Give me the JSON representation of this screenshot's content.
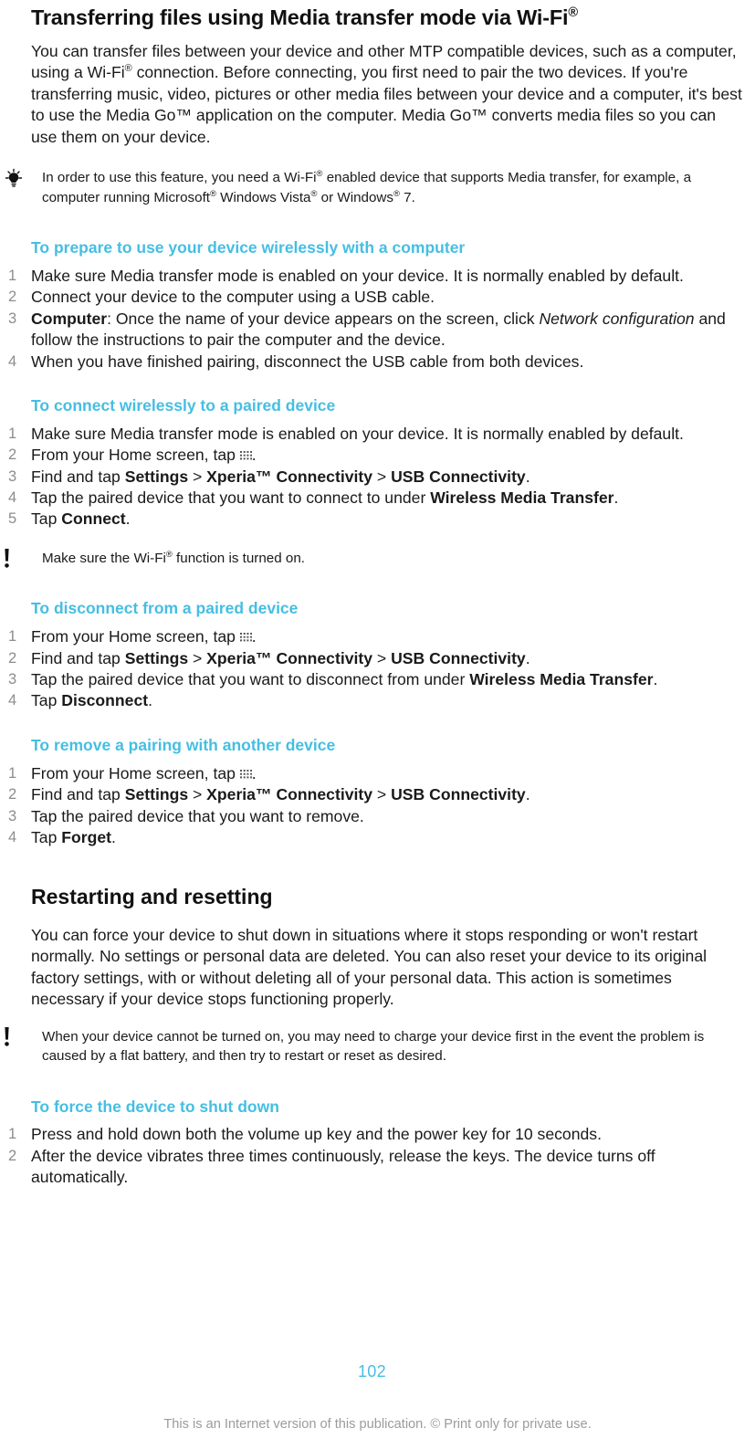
{
  "document": {
    "title_line": "Transferring files using Media transfer mode via Wi-Fi",
    "title_sup": "®",
    "intro_paragraph": {
      "p1": "You can transfer files between your device and other MTP compatible devices, such as a computer, using a Wi-Fi",
      "sup1": "®",
      "p2": " connection. Before connecting, you first need to pair the two devices. If you're transferring music, video, pictures or other media files between your device and a computer, it's best to use the Media Go™ application on the computer. Media Go™ converts media files so you can use them on your device."
    },
    "tip_note": {
      "icon": "lightbulb-icon",
      "t1": "In order to use this feature, you need a Wi-Fi",
      "sup1": "®",
      "t2": " enabled device that supports Media transfer, for example, a computer running Microsoft",
      "sup2": "®",
      "t3": " Windows Vista",
      "sup3": "®",
      "t4": " or Windows",
      "sup4": "®",
      "t5": " 7."
    },
    "section_prepare": {
      "heading": "To prepare to use your device wirelessly with a computer",
      "steps": [
        {
          "text": "Make sure Media transfer mode is enabled on your device. It is normally enabled by default."
        },
        {
          "text": "Connect your device to the computer using a USB cable."
        },
        {
          "bold_lead": "Computer",
          "text_a": ": Once the name of your device appears on the screen, click ",
          "italic": "Network configuration",
          "text_b": " and follow the instructions to pair the computer and the device."
        },
        {
          "text": "When you have finished pairing, disconnect the USB cable from both devices."
        }
      ]
    },
    "section_connect": {
      "heading": "To connect wirelessly to a paired device",
      "steps": {
        "s1": "Make sure Media transfer mode is enabled on your device. It is normally enabled by default.",
        "s2_a": "From your Home screen, tap ",
        "s2_icon": "app-drawer-icon",
        "s2_b": ".",
        "s3_a": "Find and tap ",
        "s3_b1": "Settings",
        "s3_sep1": " > ",
        "s3_b2": "Xperia™ Connectivity",
        "s3_sep2": " > ",
        "s3_b3": "USB Connectivity",
        "s3_end": ".",
        "s4_a": "Tap the paired device that you want to connect to under ",
        "s4_b": "Wireless Media Transfer",
        "s4_end": ".",
        "s5_a": "Tap ",
        "s5_b": "Connect",
        "s5_end": "."
      }
    },
    "warning_note_1": {
      "icon": "exclamation-icon",
      "t1": "Make sure the Wi-Fi",
      "sup1": "®",
      "t2": " function is turned on."
    },
    "section_disconnect": {
      "heading": "To disconnect from a paired device",
      "steps": {
        "s1_a": "From your Home screen, tap ",
        "s1_icon": "app-drawer-icon",
        "s1_b": ".",
        "s2_a": "Find and tap ",
        "s2_b1": "Settings",
        "s2_sep1": " > ",
        "s2_b2": "Xperia™ Connectivity",
        "s2_sep2": " > ",
        "s2_b3": "USB Connectivity",
        "s2_end": ".",
        "s3_a": "Tap the paired device that you want to disconnect from under ",
        "s3_b": "Wireless Media Transfer",
        "s3_end": ".",
        "s4_a": "Tap ",
        "s4_b": "Disconnect",
        "s4_end": "."
      }
    },
    "section_remove": {
      "heading": "To remove a pairing with another device",
      "steps": {
        "s1_a": "From your Home screen, tap ",
        "s1_icon": "app-drawer-icon",
        "s1_b": ".",
        "s2_a": "Find and tap ",
        "s2_b1": "Settings",
        "s2_sep1": " > ",
        "s2_b2": "Xperia™ Connectivity",
        "s2_sep2": " > ",
        "s2_b3": "USB Connectivity",
        "s2_end": ".",
        "s3": "Tap the paired device that you want to remove.",
        "s4_a": "Tap ",
        "s4_b": "Forget",
        "s4_end": "."
      }
    },
    "section_restart": {
      "heading": "Restarting and resetting",
      "paragraph": "You can force your device to shut down in situations where it stops responding or won't restart normally. No settings or personal data are deleted. You can also reset your device to its original factory settings, with or without deleting all of your personal data. This action is sometimes necessary if your device stops functioning properly."
    },
    "warning_note_2": {
      "icon": "exclamation-icon",
      "text": "When your device cannot be turned on, you may need to charge your device first in the event the problem is caused by a flat battery, and then try to restart or reset as desired."
    },
    "section_force_shutdown": {
      "heading": "To force the device to shut down",
      "steps": [
        "Press and hold down both the volume up key and the power key for 10 seconds.",
        "After the device vibrates three times continuously, release the keys. The device turns off automatically."
      ]
    },
    "footer": {
      "page_number": "102",
      "disclaimer": "This is an Internet version of this publication. © Print only for private use."
    },
    "colors": {
      "heading_blue": "#45bee3",
      "step_number_gray": "#8d8d8d",
      "body_black": "#1a1a1a",
      "footer_gray": "#9b9b9b"
    }
  }
}
